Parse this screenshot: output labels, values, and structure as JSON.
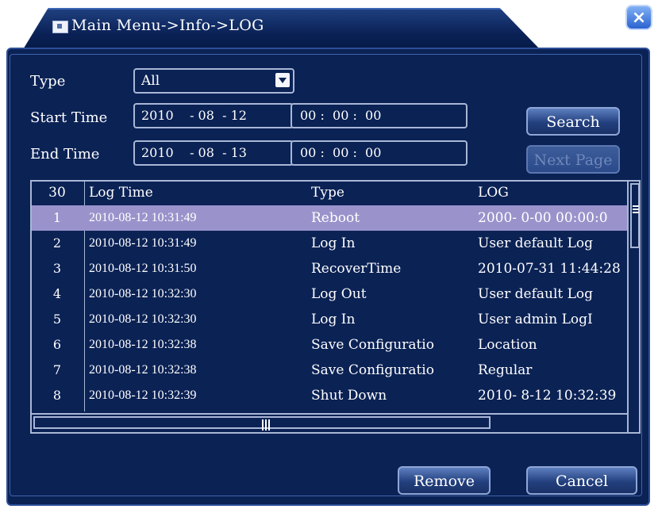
{
  "window": {
    "title": "Main Menu->Info->LOG",
    "close_label": "×"
  },
  "filters": {
    "type_label": "Type",
    "type_value": "All",
    "start_label": "Start Time",
    "start_date": "2010    - 08  - 12",
    "start_time": "00 :  00 :  00",
    "end_label": "End Time",
    "end_date": "2010    - 08  - 13",
    "end_time": "00 :  00 :  00"
  },
  "buttons": {
    "search": "Search",
    "next_page": "Next Page",
    "remove": "Remove",
    "cancel": "Cancel"
  },
  "table": {
    "headers": {
      "count": "30",
      "time": "Log Time",
      "type": "Type",
      "log": "LOG"
    },
    "rows": [
      {
        "num": "1",
        "time": "2010-08-12 10:31:49",
        "type": "Reboot",
        "log": "2000- 0-00 00:00:0"
      },
      {
        "num": "2",
        "time": "2010-08-12 10:31:49",
        "type": "Log In",
        "log": "User default Log"
      },
      {
        "num": "3",
        "time": "2010-08-12 10:31:50",
        "type": "RecoverTime",
        "log": "2010-07-31 11:44:28"
      },
      {
        "num": "4",
        "time": "2010-08-12 10:32:30",
        "type": "Log Out",
        "log": "User default Log"
      },
      {
        "num": "5",
        "time": "2010-08-12 10:32:30",
        "type": "Log In",
        "log": "User admin LogI"
      },
      {
        "num": "6",
        "time": "2010-08-12 10:32:38",
        "type": "Save Configuratio",
        "log": "Location"
      },
      {
        "num": "7",
        "time": "2010-08-12 10:32:38",
        "type": "Save Configuratio",
        "log": "Regular"
      },
      {
        "num": "8",
        "time": "2010-08-12 10:32:39",
        "type": "Shut Down",
        "log": "2010- 8-12 10:32:39"
      }
    ]
  },
  "colors": {
    "background": "#0b2255",
    "selected_row": "#9a93cb",
    "border": "#a9b7d6"
  }
}
